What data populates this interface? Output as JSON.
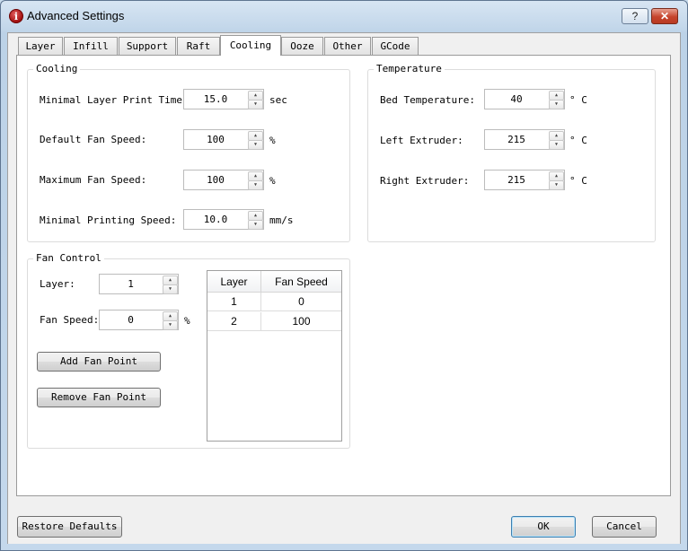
{
  "window": {
    "title": "Advanced Settings",
    "help_label": "?",
    "close_label": "✕"
  },
  "tabs": [
    {
      "label": "Layer"
    },
    {
      "label": "Infill"
    },
    {
      "label": "Support"
    },
    {
      "label": "Raft"
    },
    {
      "label": "Cooling"
    },
    {
      "label": "Ooze"
    },
    {
      "label": "Other"
    },
    {
      "label": "GCode"
    }
  ],
  "active_tab": "Cooling",
  "cooling": {
    "title": "Cooling",
    "min_layer_time": {
      "label": "Minimal Layer Print Time:",
      "value": "15.0",
      "unit": "sec"
    },
    "default_fan": {
      "label": "Default Fan Speed:",
      "value": "100",
      "unit": "%"
    },
    "max_fan": {
      "label": "Maximum Fan Speed:",
      "value": "100",
      "unit": "%"
    },
    "min_print_speed": {
      "label": "Minimal Printing Speed:",
      "value": "10.0",
      "unit": "mm/s"
    }
  },
  "temperature": {
    "title": "Temperature",
    "bed": {
      "label": "Bed Temperature:",
      "value": "40",
      "unit": "° C"
    },
    "left": {
      "label": "Left Extruder:",
      "value": "215",
      "unit": "° C"
    },
    "right": {
      "label": "Right Extruder:",
      "value": "215",
      "unit": "° C"
    }
  },
  "fan_control": {
    "title": "Fan Control",
    "layer": {
      "label": "Layer:",
      "value": "1"
    },
    "fan_speed": {
      "label": "Fan Speed:",
      "value": "0",
      "unit": "%"
    },
    "add_label": "Add Fan Point",
    "remove_label": "Remove Fan Point",
    "table": {
      "columns": [
        "Layer",
        "Fan Speed"
      ],
      "rows": [
        [
          "1",
          "0"
        ],
        [
          "2",
          "100"
        ]
      ]
    }
  },
  "footer": {
    "restore_label": "Restore Defaults",
    "ok_label": "OK",
    "cancel_label": "Cancel"
  }
}
